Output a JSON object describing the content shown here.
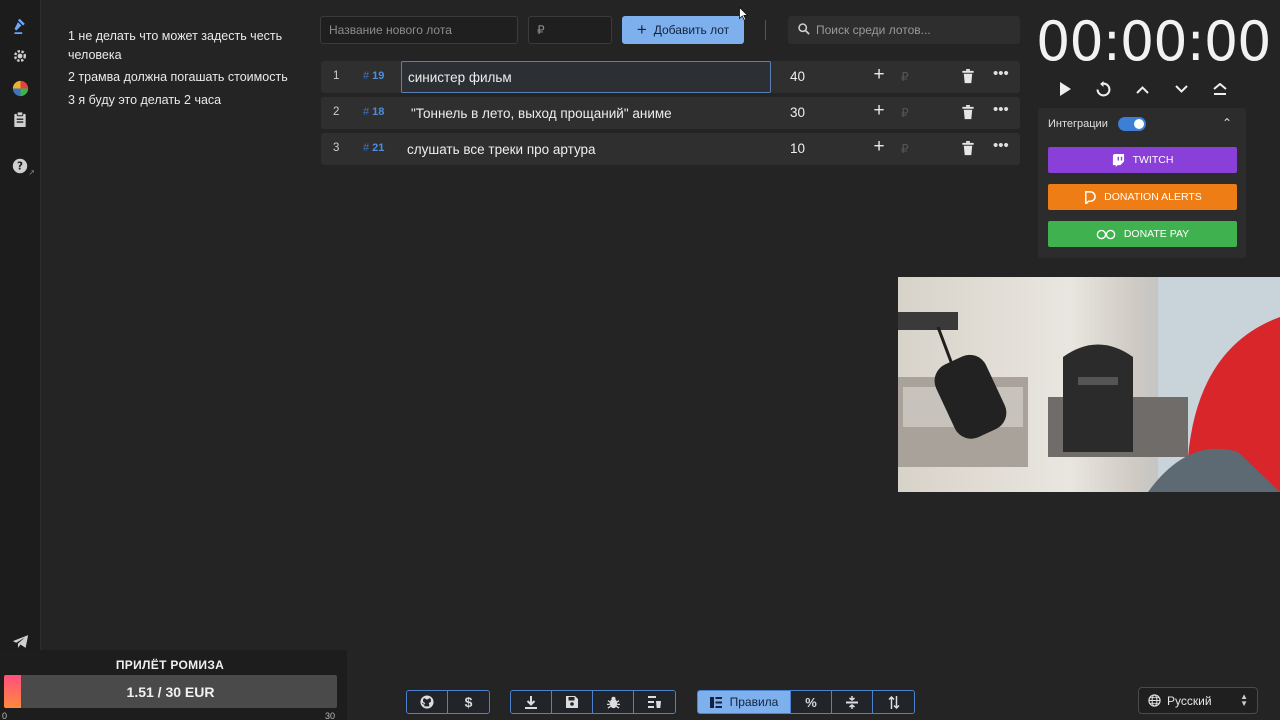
{
  "sidebar": {
    "items": [
      {
        "icon": "gavel-icon",
        "active": true
      },
      {
        "icon": "gear-icon"
      },
      {
        "icon": "pie-chart-icon"
      },
      {
        "icon": "clipboard-icon"
      },
      {
        "icon": "help-icon"
      },
      {
        "icon": "telegram-icon"
      }
    ]
  },
  "rules": [
    "1 не делать что может задесть честь человека",
    "2 трамва должна погашать стоимость",
    "3 я буду это делать 2 часа"
  ],
  "new_lot": {
    "name_placeholder": "Название нового лота",
    "amount_placeholder": "₽",
    "add_label": "Добавить лот"
  },
  "search": {
    "placeholder": "Поиск среди лотов..."
  },
  "lots": [
    {
      "index": "1",
      "fast_id": "19",
      "name": "синистер фильм",
      "amount": "40",
      "currency": "₽"
    },
    {
      "index": "2",
      "fast_id": "18",
      "name": "\"Тоннель в лето, выход прощаний\" аниме",
      "amount": "30",
      "currency": "₽"
    },
    {
      "index": "3",
      "fast_id": "21",
      "name": "слушать все треки про артура",
      "amount": "10",
      "currency": "₽"
    }
  ],
  "timer": {
    "display": "00:00:00"
  },
  "integrations": {
    "label": "Интеграции",
    "enabled": true,
    "services": [
      {
        "label": "TWITCH",
        "color": "#8b3fd9",
        "icon": "twitch-icon"
      },
      {
        "label": "DONATION ALERTS",
        "color": "#ef7d15",
        "icon": "donationalerts-icon"
      },
      {
        "label": "DONATE PAY",
        "color": "#3fb24f",
        "icon": "donatepay-icon"
      }
    ]
  },
  "donation_goal": {
    "title": "ПРИЛЁТ РОМИЗА",
    "progress_text": "1.51 / 30 EUR",
    "current": 1.51,
    "target": 30,
    "min_label": "0",
    "max_label": "30"
  },
  "toolbar": {
    "rules_label": "Правила",
    "groups": [
      [
        "github-icon",
        "dollar-icon"
      ],
      [
        "download-icon",
        "save-icon",
        "bug-icon",
        "clear-list-icon"
      ],
      [
        "rules-button",
        "percent-icon",
        "split-icon",
        "sort-icon"
      ]
    ]
  },
  "language": {
    "selected": "Русский"
  },
  "colors": {
    "accent": "#7fb0ee",
    "background": "#242424",
    "panel": "#2f2f2f",
    "fast_id": "#4d8de0"
  }
}
